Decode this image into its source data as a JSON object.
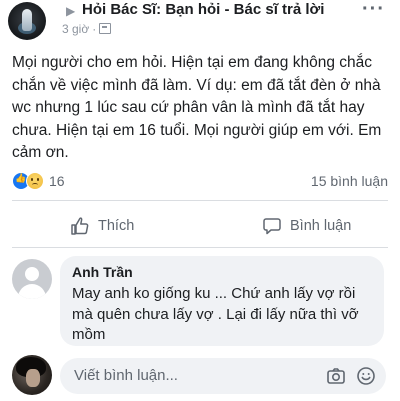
{
  "post": {
    "group_name": "Hỏi Bác Sĩ: Bạn hỏi - Bác sĩ trả lời",
    "time": "3 giờ",
    "dot": "·",
    "body": "Mọi người cho em hỏi. Hiện tại em đang không chắc chắn về việc mình đã làm. Ví dụ: em đã tắt đèn ở nhà wc nhưng 1 lúc sau cứ phân vân là mình đã tắt hay chưa. Hiện tại em 16 tuổi. Mọi người giúp em với. Em cảm ơn.",
    "reaction_count": "16",
    "comment_count": "15 bình luận"
  },
  "actions": {
    "like_label": "Thích",
    "comment_label": "Bình luận"
  },
  "comment": {
    "author": "Anh Trần",
    "text": "May anh ko giống ku ... Chứ anh lấy vợ rồi mà quên chưa lấy vợ . Lại đi lấy nữa thì vỡ mồm"
  },
  "composer": {
    "placeholder": "Viết bình luận..."
  },
  "colors": {
    "like_blue": "#1877f2",
    "bubble_gray": "#f0f2f5",
    "secondary_text": "#606770"
  },
  "icons": [
    "group-avatar-icon",
    "arrow-right-icon",
    "more-options-icon",
    "group-privacy-icon",
    "like-reaction-icon",
    "sad-reaction-icon",
    "thumbs-up-icon",
    "comment-icon",
    "camera-icon",
    "emoji-icon"
  ]
}
